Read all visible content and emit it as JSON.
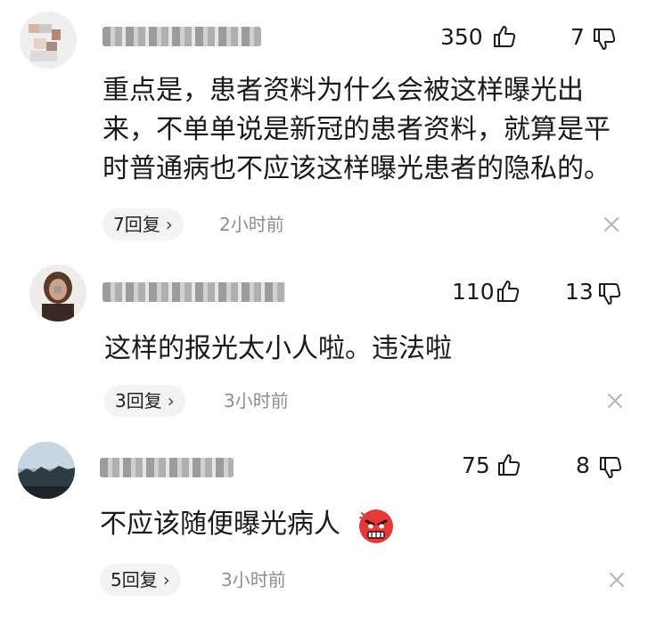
{
  "comments": [
    {
      "likes": "350",
      "dislikes": "7",
      "lines": [
        "重点是，患者资料为什么会被这样曝光出",
        "来，不单单说是新冠的患者资料，就算是平",
        "时普通病也不应该这样曝光患者的隐私的。"
      ],
      "reply_count": "7回复",
      "time": "2小时前"
    },
    {
      "likes": "110",
      "dislikes": "13",
      "lines": [
        "这样的报光太小人啦。违法啦"
      ],
      "reply_count": "3回复",
      "time": "3小时前"
    },
    {
      "likes": "75",
      "dislikes": "8",
      "lines": [
        "不应该随便曝光病人"
      ],
      "reply_count": "5回复",
      "time": "3小时前"
    }
  ],
  "icons": {
    "like": "thumbs-up-icon",
    "dislike": "thumbs-down-icon",
    "close": "close-icon",
    "emoji": "angry-face-emoji"
  },
  "colors": {
    "time": "#8e8e8e",
    "reply_bg": "#f3f3f3",
    "emoji": "#e53935"
  }
}
